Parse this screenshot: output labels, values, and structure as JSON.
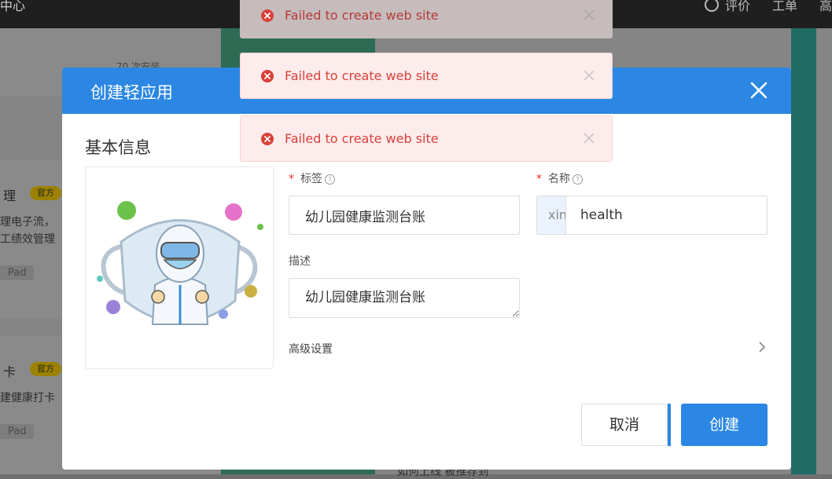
{
  "background": {
    "topbar_left": "中心",
    "topbar_right": [
      "评价",
      "工单",
      "高"
    ],
    "count_text": "70 次安装",
    "cards": [
      {
        "title": "理",
        "badge": "官方",
        "desc1": "理电子流，",
        "desc2": "工绩效管理",
        "chip": "Pad"
      },
      {
        "title": "卡",
        "badge": "官方",
        "desc1": "建健康打卡",
        "desc2": "",
        "chip": "Pad"
      }
    ],
    "bottom_text": "如何上线   被推荐到"
  },
  "modal": {
    "title": "创建轻应用",
    "section_title": "基本信息",
    "tag_label": "标签",
    "tag_value": "幼儿园健康监测台账",
    "name_label": "名称",
    "name_prefix": "xintiaobao__",
    "name_value": "health",
    "desc_label": "描述",
    "desc_value": "幼儿园健康监测台账",
    "advanced_label": "高级设置",
    "cancel_label": "取消",
    "create_label": "创建",
    "help_mark": "?",
    "required_mark": "*"
  },
  "toasts": [
    {
      "message": "Failed to create web site"
    },
    {
      "message": "Failed to create web site"
    },
    {
      "message": "Failed to create web site"
    }
  ],
  "colors": {
    "primary": "#2b87e3",
    "error": "#d9403a",
    "error_bg": "#fdecec"
  }
}
